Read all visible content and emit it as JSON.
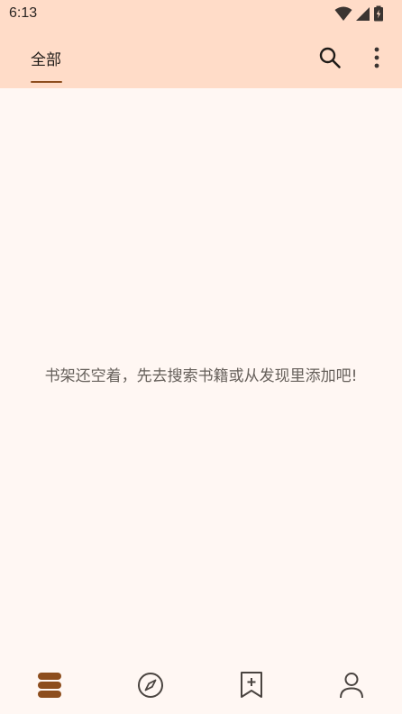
{
  "status_bar": {
    "time": "6:13"
  },
  "app_bar": {
    "tabs": [
      {
        "label": "全部",
        "selected": true
      }
    ],
    "actions": [
      "search-icon",
      "more-vert-icon"
    ]
  },
  "empty_state": {
    "message": "书架还空着，先去搜索书籍或从发现里添加吧!"
  },
  "bottom_nav": {
    "items": [
      {
        "icon": "bookshelf-icon",
        "selected": true
      },
      {
        "icon": "compass-icon",
        "selected": false
      },
      {
        "icon": "bookmark-add-icon",
        "selected": false
      },
      {
        "icon": "person-icon",
        "selected": false
      }
    ]
  },
  "colors": {
    "header_bg": "#ffdcc8",
    "page_bg": "#fff7f3",
    "accent": "#8d4d1d",
    "text_secondary": "#66605b"
  }
}
